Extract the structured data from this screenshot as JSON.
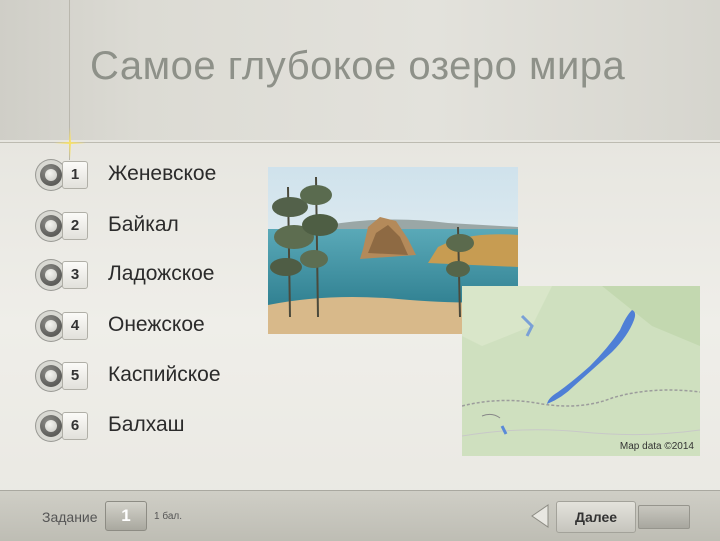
{
  "slide": {
    "title": "Самое глубокое озеро мира"
  },
  "options": [
    {
      "number": "1",
      "label": "Женевское"
    },
    {
      "number": "2",
      "label": "Байкал"
    },
    {
      "number": "3",
      "label": "Ладожское"
    },
    {
      "number": "4",
      "label": "Онежское"
    },
    {
      "number": "5",
      "label": "Каспийское"
    },
    {
      "number": "6",
      "label": "Балхаш"
    }
  ],
  "map": {
    "attribution": "Map data ©2014"
  },
  "footer": {
    "task_label": "Задание",
    "task_number": "1",
    "score": "1 бал.",
    "next_label": "Далее"
  },
  "colors": {
    "title": "#8e9189",
    "lake_water": "#4a8fb0",
    "map_lake": "#4f7fd6",
    "map_land": "#cfe0bf"
  }
}
